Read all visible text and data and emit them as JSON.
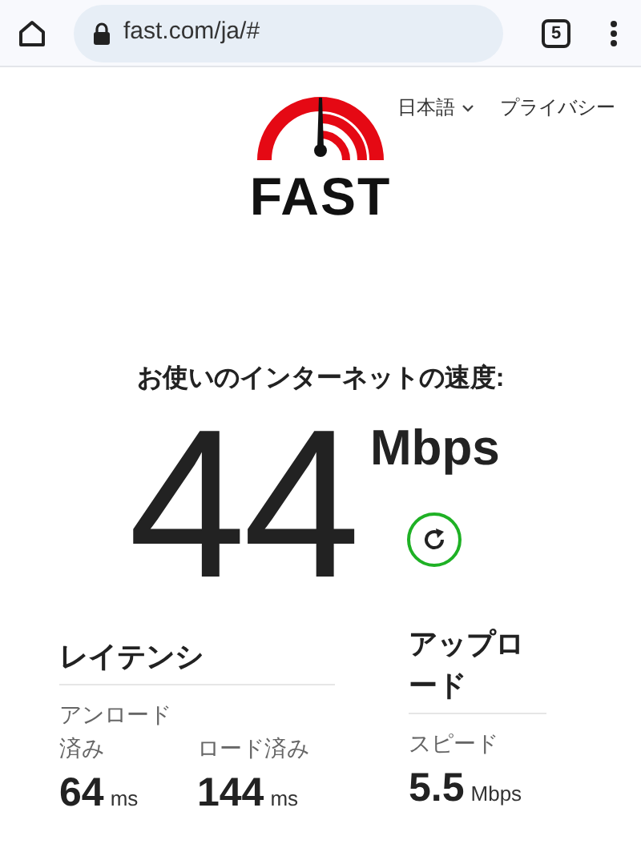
{
  "browser": {
    "url": "fast.com/ja/#",
    "tab_count": "5"
  },
  "nav": {
    "language": "日本語",
    "privacy": "プライバシー"
  },
  "logo": {
    "text": "FAST"
  },
  "speed": {
    "heading": "お使いのインターネットの速度:",
    "value": "44",
    "unit": "Mbps"
  },
  "latency": {
    "title": "レイテンシ",
    "metrics": [
      {
        "label": "アンロード済み",
        "value": "64",
        "unit": "ms"
      },
      {
        "label": "ロード済み",
        "value": "144",
        "unit": "ms"
      }
    ]
  },
  "upload": {
    "title": "アップロード",
    "metrics": [
      {
        "label": "スピード",
        "value": "5.5",
        "unit": "Mbps"
      }
    ]
  }
}
